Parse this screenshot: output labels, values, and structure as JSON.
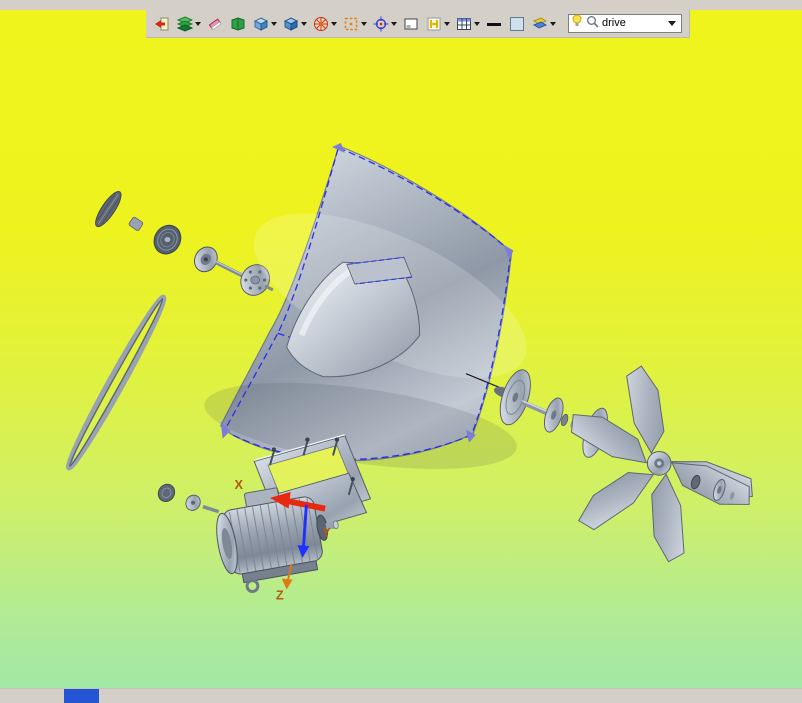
{
  "toolbar": {
    "icons": [
      {
        "name": "exit-sketch-icon",
        "dropdown": false
      },
      {
        "name": "layers-icon",
        "dropdown": true
      },
      {
        "name": "eraser-icon",
        "dropdown": false
      },
      {
        "name": "notebook-icon",
        "dropdown": false
      },
      {
        "name": "shaded-cube-icon",
        "dropdown": true
      },
      {
        "name": "view-orientation-cube-icon",
        "dropdown": true
      },
      {
        "name": "color-wheel-icon",
        "dropdown": true
      },
      {
        "name": "selection-box-icon",
        "dropdown": true
      },
      {
        "name": "target-icon",
        "dropdown": true
      },
      {
        "name": "viewport-icon",
        "dropdown": false
      },
      {
        "name": "hatch-icon",
        "dropdown": true
      },
      {
        "name": "table-icon",
        "dropdown": true
      },
      {
        "name": "line-weight-icon",
        "dropdown": false
      },
      {
        "name": "color-swatch-icon",
        "dropdown": false
      },
      {
        "name": "display-style-icon",
        "dropdown": true
      }
    ],
    "search": {
      "value": "drive",
      "left_icons": [
        "lightbulb-icon",
        "magnifier-icon"
      ]
    }
  },
  "canvas": {
    "axis_labels": {
      "x": "X",
      "y": "Y",
      "z": "Z"
    },
    "parts": [
      "belt",
      "idler-pulley-train",
      "fan-housing",
      "inner-duct",
      "mount-frame",
      "motor",
      "drive-shaft-train",
      "propeller",
      "hub-parts"
    ]
  },
  "colors": {
    "background_top": "#f0f41d",
    "background_bottom": "#a2e8a6",
    "toolbar_gray": "#d4d0c8",
    "selection_dash_blue": "#2a2af2",
    "corner_accent_purple": "#7d7dd8",
    "axis_label_orange": "#b35a12",
    "triad_red": "#e82810",
    "triad_blue": "#2030ff",
    "taskbar_accent_blue": "#2355d4",
    "metal_light": "#d6dbe2",
    "metal_dark": "#8e98a6"
  }
}
